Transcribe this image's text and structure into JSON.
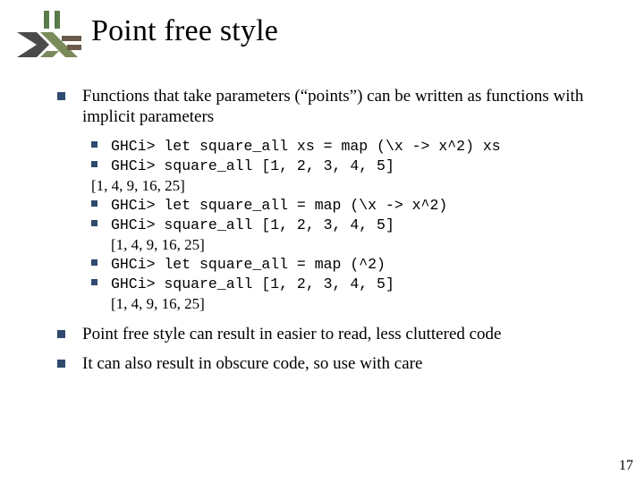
{
  "title": "Point free style",
  "bullets": {
    "l1a": "Functions that take parameters (“points”) can be written as functions with implicit parameters",
    "l1b": "Point free style can result in easier to read, less cluttered code",
    "l1c": "It can also result in obscure code, so use with care"
  },
  "code": {
    "l1": "GHCi> let square_all xs = map (\\x -> x^2) xs",
    "l2": "GHCi> square_all [1, 2, 3, 4, 5]",
    "o1": "[1, 4, 9, 16, 25]",
    "l3": "GHCi> let square_all = map (\\x -> x^2)",
    "l4": "GHCi> square_all [1, 2, 3, 4, 5]",
    "o2": "[1, 4, 9, 16, 25]",
    "l5": "GHCi> let square_all = map (^2)",
    "l6": "GHCi> square_all [1, 2, 3, 4, 5]",
    "o3": "[1, 4, 9, 16, 25]"
  },
  "page_number": "17"
}
